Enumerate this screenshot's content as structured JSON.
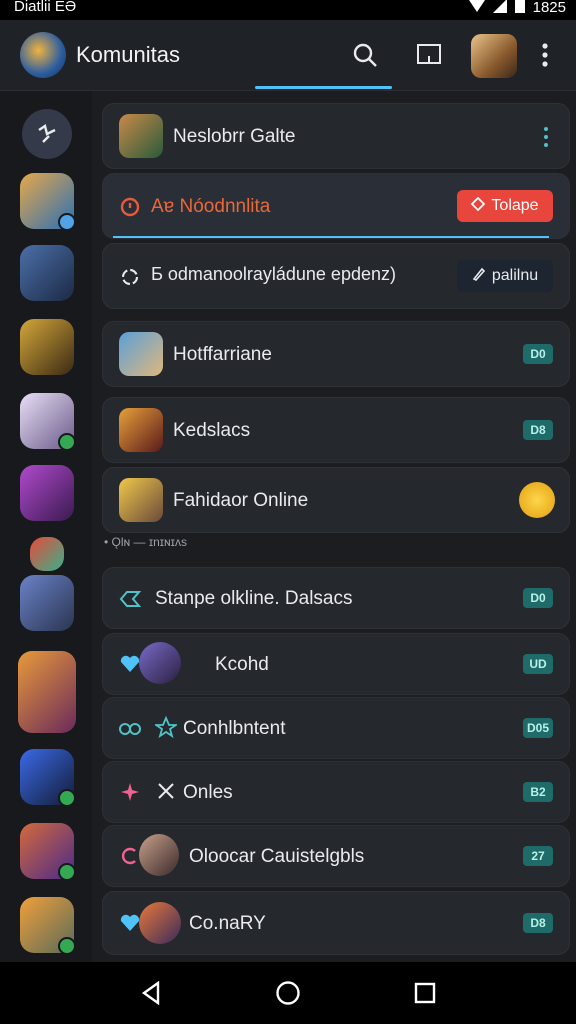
{
  "status": {
    "carrier": "Diatlii ЀƏ",
    "time": "1825"
  },
  "appbar": {
    "title": "Komunitas"
  },
  "cards": [
    {
      "label": "Neslobrr Galte"
    },
    {
      "label": "Aɐ Nóodnnlita",
      "action": "Tolape"
    },
    {
      "label": "Ƃ odmanoolrayládune epdenz)",
      "action": "palilnu"
    },
    {
      "label": "Hotffarriane",
      "badge": "D0"
    },
    {
      "label": "Kedslacs",
      "badge": "D8"
    },
    {
      "label": "Fahidaor Online"
    },
    {
      "label": "Stanpe olkline. Dalsacs",
      "badge": "D0"
    },
    {
      "label": "Kcohd",
      "badge": "UD"
    },
    {
      "label": "Conhlbntent",
      "badge": "D05"
    },
    {
      "label": "Onles",
      "badge": "B2"
    },
    {
      "label": "Oloocar Cauistelgbls",
      "badge": "27"
    },
    {
      "label": "Co.naRY",
      "badge": "D8"
    }
  ],
  "section_label": "• Ǫlɴ — ɪnɪɴɪʌs"
}
